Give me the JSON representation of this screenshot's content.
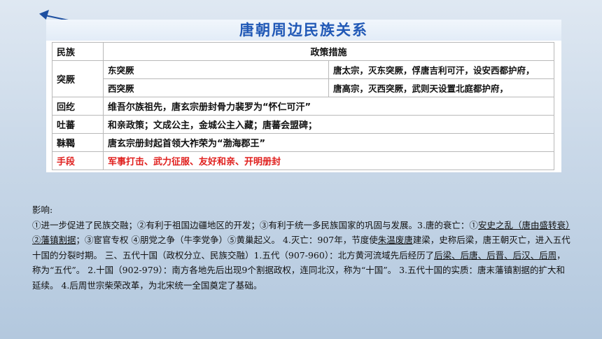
{
  "table": {
    "title": "唐朝周边民族关系",
    "header": {
      "col1": "民族",
      "col2": "政策措施"
    },
    "tujue": {
      "label": "突厥",
      "east": {
        "name": "东突厥",
        "policy": "唐太宗，灭东突厥，俘唐吉利可汗，设安西都护府，"
      },
      "west": {
        "name": "西突厥",
        "policy": "唐高宗，灭西突厥，武则天设置北庭都护府，"
      }
    },
    "rows": [
      {
        "label": "回纥",
        "policy": "维吾尔族祖先，唐玄宗册封骨力裴罗为“怀仁可汗”"
      },
      {
        "label": "吐蕃",
        "policy": "和亲政策；文成公主，金城公主入藏；唐蕃会盟碑；"
      },
      {
        "label": "靺鞨",
        "policy": "唐玄宗册封起首领大祚荣为“渤海郡王”"
      }
    ],
    "means": {
      "label": "手段",
      "policy": "军事打击、武力征服、友好和亲、开明册封"
    },
    "colors": {
      "title": "#2058b6",
      "means": "#e0201e"
    }
  },
  "text": {
    "heading": "影响:",
    "s1": "①进一步促进了民族交融；②有利于祖国边疆地区的开发；③有利于统一多民族国家的巩固与发展。3.唐的衰亡：①",
    "u1": "安史之乱（唐由盛转衰）②藩镇割据",
    "s2": "；③宦官专权 ④朋党之争（牛李党争）⑤黄巢起义。 4.灭亡：907年，节度使",
    "u2": "朱温废唐",
    "s3": "建梁，史称后梁，唐王朝灭亡，进入五代十国的分裂时期。 三、五代十国（政权分立、民族交融）1.五代（907-960）：北方黄河流域先后经历了",
    "u3": "后梁、后唐、后晋、后汉、后周",
    "s4": "，称为“五代”。 2.十国（902-979）：南方各地先后出现9个割据政权，连同北汉，称为“十国”。   3.五代十国的实质：唐末藩镇割据的扩大和延续。 4.后周世宗柴荣改革，为北宋统一全国奠定了基础。"
  }
}
